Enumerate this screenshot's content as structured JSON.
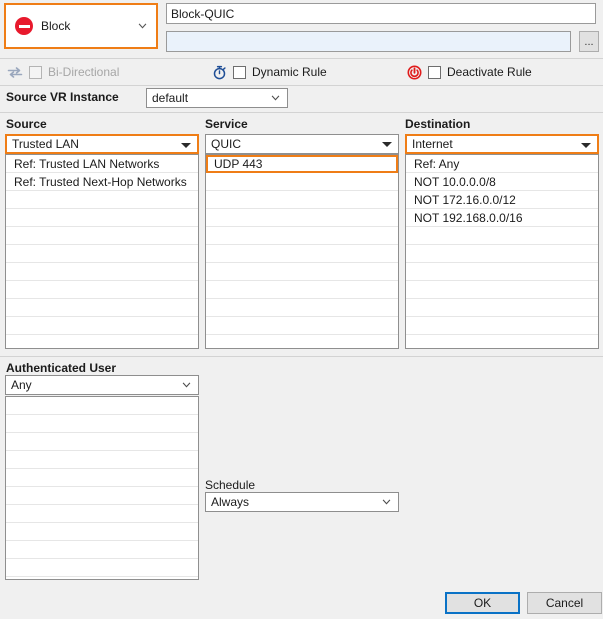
{
  "dialog": {
    "action": {
      "label": "Block",
      "icon": "block-icon",
      "accent_color": "#ef7d16",
      "icon_color": "#e8192c"
    },
    "name_field": {
      "value": "Block-QUIC",
      "placeholder": ""
    },
    "description_field": {
      "value": "",
      "placeholder": ""
    },
    "browse_button": {
      "label": "..."
    },
    "options": [
      {
        "id": "bi-directional",
        "label": "Bi-Directional",
        "checked": false,
        "disabled": true,
        "icon": "bidirectional-arrows-icon"
      },
      {
        "id": "dynamic-rule",
        "label": "Dynamic Rule",
        "checked": false,
        "disabled": false,
        "icon": "stopwatch-icon"
      },
      {
        "id": "deactivate-rule",
        "label": "Deactivate Rule",
        "checked": false,
        "disabled": false,
        "icon": "power-icon"
      }
    ],
    "source_vr_instance": {
      "label": "Source VR Instance",
      "value": "default"
    },
    "columns": [
      {
        "id": "source",
        "title": "Source",
        "selected": "Trusted  LAN",
        "highlighted": true,
        "items": [
          {
            "text": "Ref: Trusted LAN Networks",
            "highlighted": false
          },
          {
            "text": "Ref: Trusted Next-Hop Networks",
            "highlighted": false
          }
        ]
      },
      {
        "id": "service",
        "title": "Service",
        "selected": "QUIC",
        "highlighted": false,
        "items": [
          {
            "text": "UDP  443",
            "highlighted": true
          }
        ]
      },
      {
        "id": "destination",
        "title": "Destination",
        "selected": "Internet",
        "highlighted": true,
        "items": [
          {
            "text": "Ref: Any",
            "highlighted": false
          },
          {
            "text": "NOT 10.0.0.0/8",
            "highlighted": false
          },
          {
            "text": "NOT 172.16.0.0/12",
            "highlighted": false
          },
          {
            "text": "NOT 192.168.0.0/16",
            "highlighted": false
          }
        ]
      }
    ],
    "authenticated_user": {
      "label": "Authenticated User",
      "value": "Any",
      "items": []
    },
    "schedule": {
      "label": "Schedule",
      "value": "Always"
    },
    "footer": {
      "ok_label": "OK",
      "cancel_label": "Cancel",
      "focus_color": "#0a72c6"
    }
  }
}
